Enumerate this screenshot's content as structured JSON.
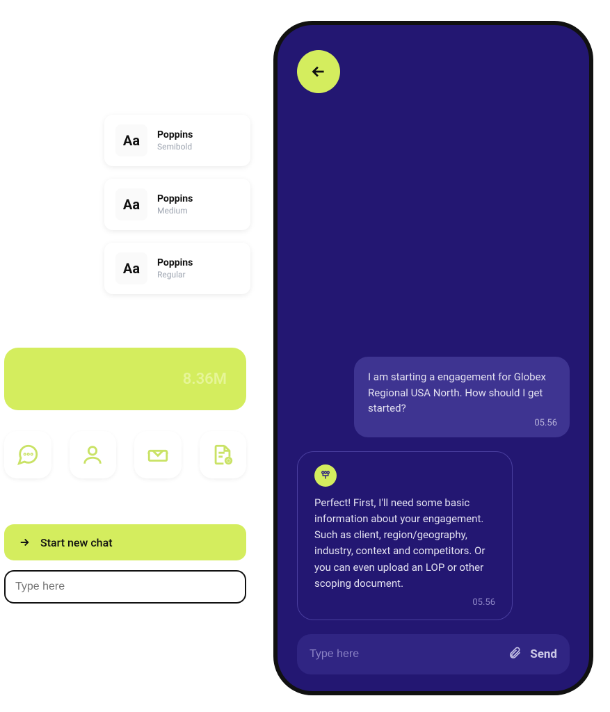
{
  "fonts": [
    {
      "sample": "Aa",
      "name": "Poppins",
      "weight": "Semibold"
    },
    {
      "sample": "Aa",
      "name": "Poppins",
      "weight": "Medium"
    },
    {
      "sample": "Aa",
      "name": "Poppins",
      "weight": "Regular"
    }
  ],
  "metric": {
    "value": "8.36M"
  },
  "actions": {
    "start_chat": "Start new chat",
    "type_placeholder": "Type here"
  },
  "chat": {
    "user_message": "I am starting a engagement for Globex Regional USA North. How should I get started?",
    "user_ts": "05.56",
    "bot_message": "Perfect! First, I'll need some basic information about your engagement.\nSuch as client, region/geography, industry, context and competitors. Or you can even upload an LOP or other scoping document.",
    "bot_ts": "05.56",
    "input_placeholder": "Type here",
    "send_label": "Send"
  }
}
